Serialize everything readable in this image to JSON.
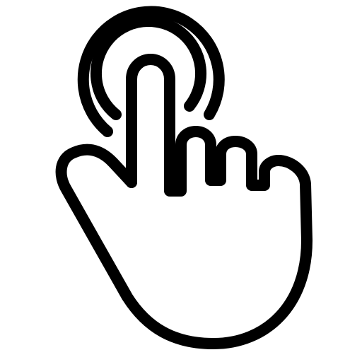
{
  "icon": {
    "name": "tap-gesture-icon",
    "stroke_color": "#000000",
    "fill_color": "#ffffff",
    "background": "#ffffff"
  }
}
